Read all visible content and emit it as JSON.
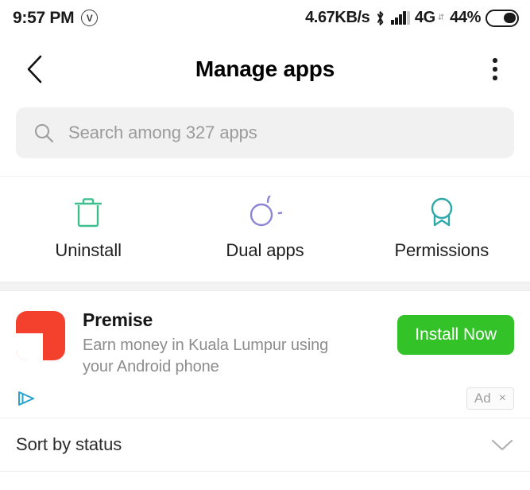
{
  "status_bar": {
    "time": "9:57 PM",
    "vpn_badge": "V",
    "network_speed": "4.67KB/s",
    "network_type": "4G",
    "network_arrows": "⇵",
    "battery_percent": "44%"
  },
  "app_bar": {
    "title": "Manage apps",
    "back_icon": "chevron-left-icon",
    "overflow_icon": "more-vertical-icon"
  },
  "search": {
    "placeholder": "Search among 327 apps",
    "icon": "search-icon",
    "app_count": "327"
  },
  "quick_actions": [
    {
      "label": "Uninstall",
      "icon": "trash-icon",
      "color": "#3fbf8f"
    },
    {
      "label": "Dual apps",
      "icon": "dual-circles-icon",
      "color": "#8b85d6"
    },
    {
      "label": "Permissions",
      "icon": "badge-award-icon",
      "color": "#2fa8a8"
    }
  ],
  "ad": {
    "title": "Premise",
    "description": "Earn money in Kuala Lumpur using your Android phone",
    "cta_label": "Install Now",
    "cta_color": "#34c229",
    "icon_color": "#f4412e",
    "adchoices_icon": "adchoices-triangle-icon",
    "badge_label": "Ad",
    "badge_close": "×"
  },
  "sort": {
    "label": "Sort by status",
    "chevron_icon": "chevron-down-icon"
  }
}
